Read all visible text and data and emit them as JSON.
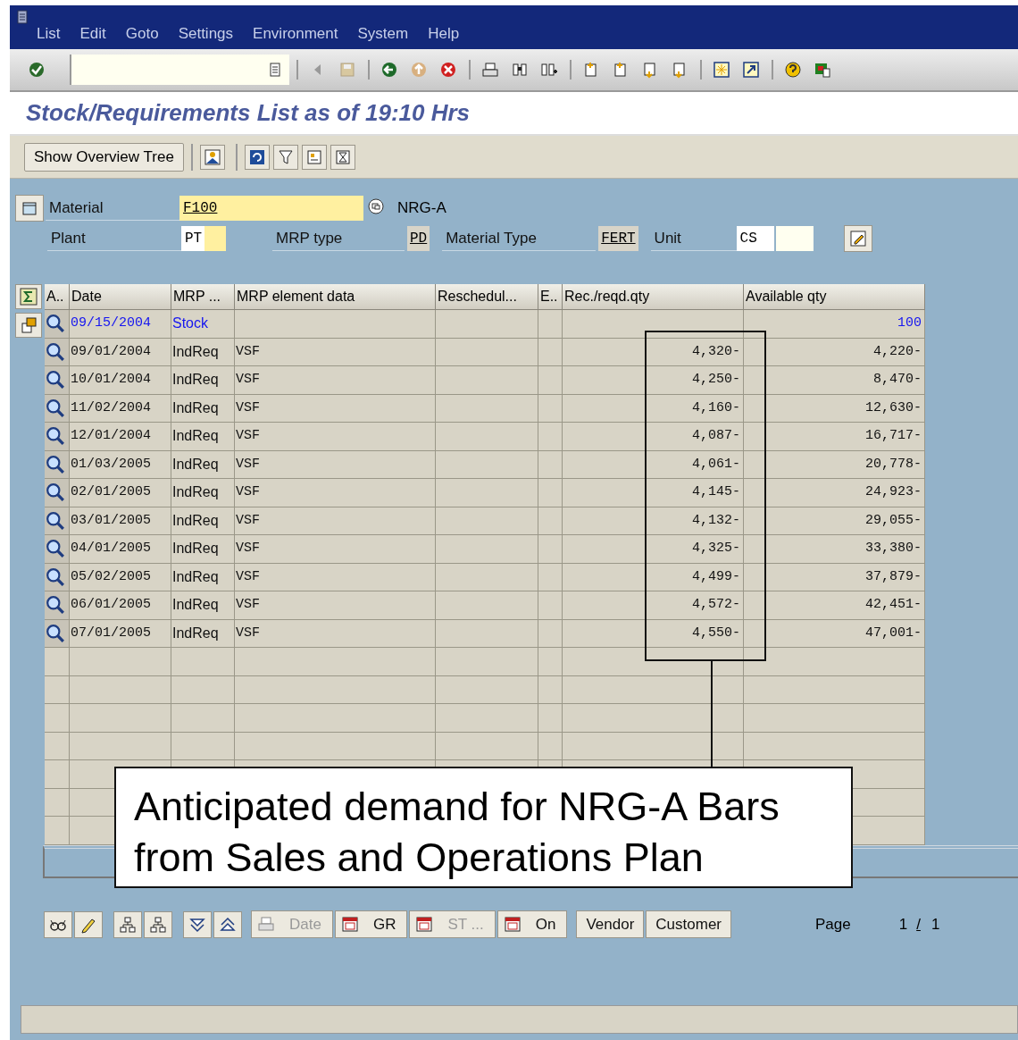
{
  "menu": [
    {
      "label": "List"
    },
    {
      "label": "Edit"
    },
    {
      "label": "Goto"
    },
    {
      "label": "Settings"
    },
    {
      "label": "Environment"
    },
    {
      "label": "System"
    },
    {
      "label": "Help"
    }
  ],
  "title": "Stock/Requirements List as of 19:10 Hrs",
  "app_toolbar": {
    "button": "Show Overview Tree"
  },
  "header": {
    "material_label": "Material",
    "material": "F100",
    "material_text": "NRG-A",
    "plant_label": "Plant",
    "plant": "PT",
    "mrp_type_label": "MRP type",
    "mrp_type": "PD",
    "material_type_label": "Material Type",
    "material_type": "FERT",
    "unit_label": "Unit",
    "unit": "CS"
  },
  "table": {
    "columns": [
      "A..",
      "Date",
      "MRP ...",
      "MRP element data",
      "Reschedul...",
      "E..",
      "Rec./reqd.qty",
      "Available qty"
    ],
    "rows": [
      {
        "kind": "stock",
        "date": "09/15/2004",
        "mrp": "Stock",
        "element": "",
        "qty": "",
        "available": "100"
      },
      {
        "kind": "req",
        "date": "09/01/2004",
        "mrp": "IndReq",
        "element": "VSF",
        "qty": "4,320-",
        "available": "4,220-"
      },
      {
        "kind": "req",
        "date": "10/01/2004",
        "mrp": "IndReq",
        "element": "VSF",
        "qty": "4,250-",
        "available": "8,470-"
      },
      {
        "kind": "req",
        "date": "11/02/2004",
        "mrp": "IndReq",
        "element": "VSF",
        "qty": "4,160-",
        "available": "12,630-"
      },
      {
        "kind": "req",
        "date": "12/01/2004",
        "mrp": "IndReq",
        "element": "VSF",
        "qty": "4,087-",
        "available": "16,717-"
      },
      {
        "kind": "req",
        "date": "01/03/2005",
        "mrp": "IndReq",
        "element": "VSF",
        "qty": "4,061-",
        "available": "20,778-"
      },
      {
        "kind": "req",
        "date": "02/01/2005",
        "mrp": "IndReq",
        "element": "VSF",
        "qty": "4,145-",
        "available": "24,923-"
      },
      {
        "kind": "req",
        "date": "03/01/2005",
        "mrp": "IndReq",
        "element": "VSF",
        "qty": "4,132-",
        "available": "29,055-"
      },
      {
        "kind": "req",
        "date": "04/01/2005",
        "mrp": "IndReq",
        "element": "VSF",
        "qty": "4,325-",
        "available": "33,380-"
      },
      {
        "kind": "req",
        "date": "05/02/2005",
        "mrp": "IndReq",
        "element": "VSF",
        "qty": "4,499-",
        "available": "37,879-"
      },
      {
        "kind": "req",
        "date": "06/01/2005",
        "mrp": "IndReq",
        "element": "VSF",
        "qty": "4,572-",
        "available": "42,451-"
      },
      {
        "kind": "req",
        "date": "07/01/2005",
        "mrp": "IndReq",
        "element": "VSF",
        "qty": "4,550-",
        "available": "47,001-"
      }
    ]
  },
  "bottom_buttons": [
    {
      "label": "Date",
      "disabled": true,
      "kind": "icon-text"
    },
    {
      "label": "GR",
      "disabled": false,
      "kind": "icon-text"
    },
    {
      "label": "ST ...",
      "disabled": true,
      "kind": "icon-text"
    },
    {
      "label": "On",
      "disabled": false,
      "kind": "icon-text"
    },
    {
      "label": "Vendor",
      "disabled": false,
      "kind": "text"
    },
    {
      "label": "Customer",
      "disabled": false,
      "kind": "text"
    }
  ],
  "page": {
    "label": "Page",
    "current": "1",
    "separator": "/",
    "total": "1"
  },
  "callout": {
    "lines": [
      "Anticipated demand for NRG-A Bars",
      "from Sales and Operations Plan"
    ]
  }
}
